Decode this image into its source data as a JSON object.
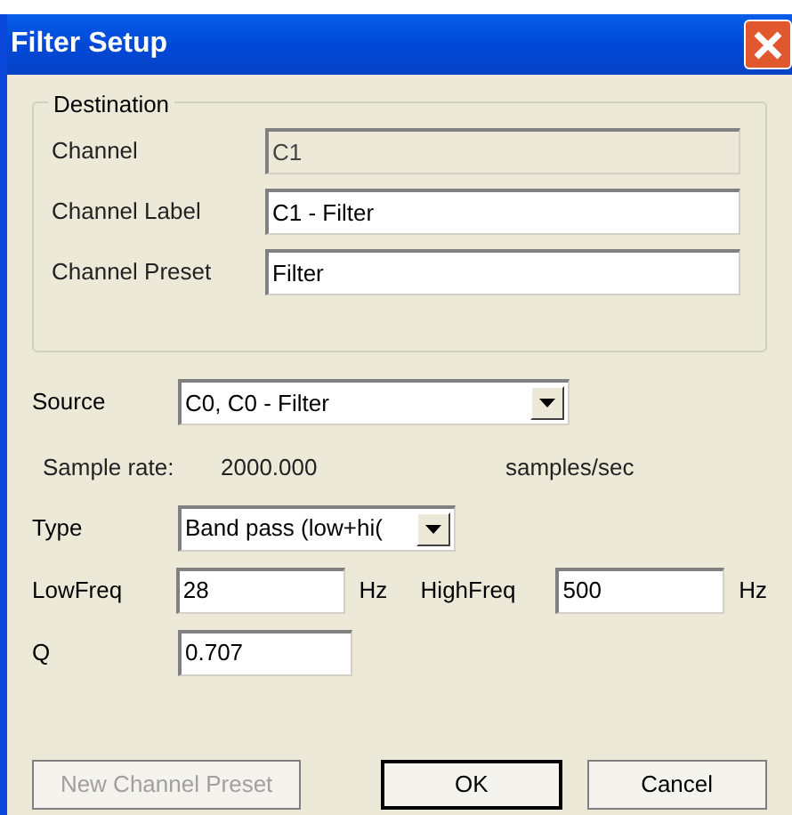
{
  "window": {
    "title": "Filter Setup"
  },
  "destination": {
    "legend": "Destination",
    "rows": [
      {
        "label": "Channel",
        "value": "C1",
        "disabled": true
      },
      {
        "label": "Channel Label",
        "value": "C1 - Filter",
        "disabled": false
      },
      {
        "label": "Channel Preset",
        "value": "Filter",
        "disabled": false
      }
    ]
  },
  "source": {
    "label": "Source",
    "value": "C0, C0 - Filter"
  },
  "sample_rate": {
    "label": "Sample rate:",
    "value": "2000.000",
    "unit": "samples/sec"
  },
  "type": {
    "label": "Type",
    "value": "Band pass (low+hi("
  },
  "low_freq": {
    "label": "LowFreq",
    "value": "28",
    "unit": "Hz"
  },
  "high_freq": {
    "label": "HighFreq",
    "value": "500",
    "unit": "Hz"
  },
  "q": {
    "label": "Q",
    "value": "0.707"
  },
  "buttons": [
    {
      "label": "New Channel Preset",
      "disabled": true,
      "default": false
    },
    {
      "label": "OK",
      "disabled": false,
      "default": true
    },
    {
      "label": "Cancel",
      "disabled": false,
      "default": false
    }
  ]
}
